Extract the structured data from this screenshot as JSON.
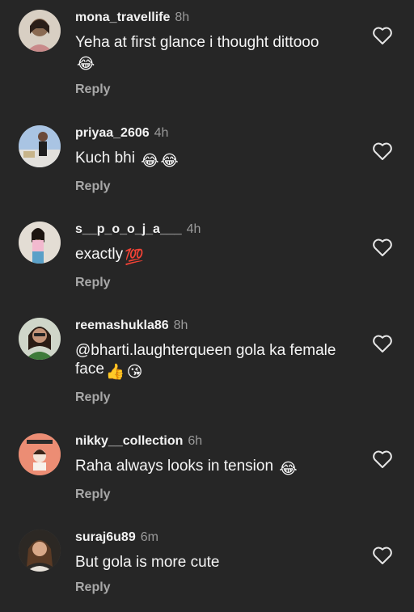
{
  "comments": [
    {
      "username": "mona_travellife",
      "time": "8h",
      "text": "Yeha at first glance i thought dittooo",
      "emojis": [
        "😂"
      ],
      "reply": "Reply",
      "avatar_color": "#c9b9a6"
    },
    {
      "username": "priyaa_2606",
      "time": "4h",
      "text": "Kuch bhi",
      "emojis": [
        "😂",
        "😂"
      ],
      "reply": "Reply",
      "avatar_color": "#9bb6d8"
    },
    {
      "username": "s__p_o_o_j_a___",
      "time": "4h",
      "text": "exactly",
      "emojis": [
        "💯"
      ],
      "reply": "Reply",
      "avatar_color": "#d9d0c6"
    },
    {
      "username": "reemashukla86",
      "time": "8h",
      "text": "@bharti.laughterqueen gola ka female face",
      "emojis": [
        "👍",
        "😘"
      ],
      "reply": "Reply",
      "avatar_color": "#5f7d55"
    },
    {
      "username": "nikky__collection",
      "time": "6h",
      "text": "Raha always looks in tension",
      "emojis": [
        "😂"
      ],
      "reply": "Reply",
      "avatar_color": "#e8806a"
    },
    {
      "username": "suraj6u89",
      "time": "6m",
      "text": "But gola is more cute",
      "emojis": [],
      "reply": "Reply",
      "avatar_color": "#3a3530"
    }
  ],
  "icons": {
    "like": "heart-icon"
  },
  "colors": {
    "background": "#262626",
    "username": "#f2f2f2",
    "secondary": "#9a9a9a"
  }
}
